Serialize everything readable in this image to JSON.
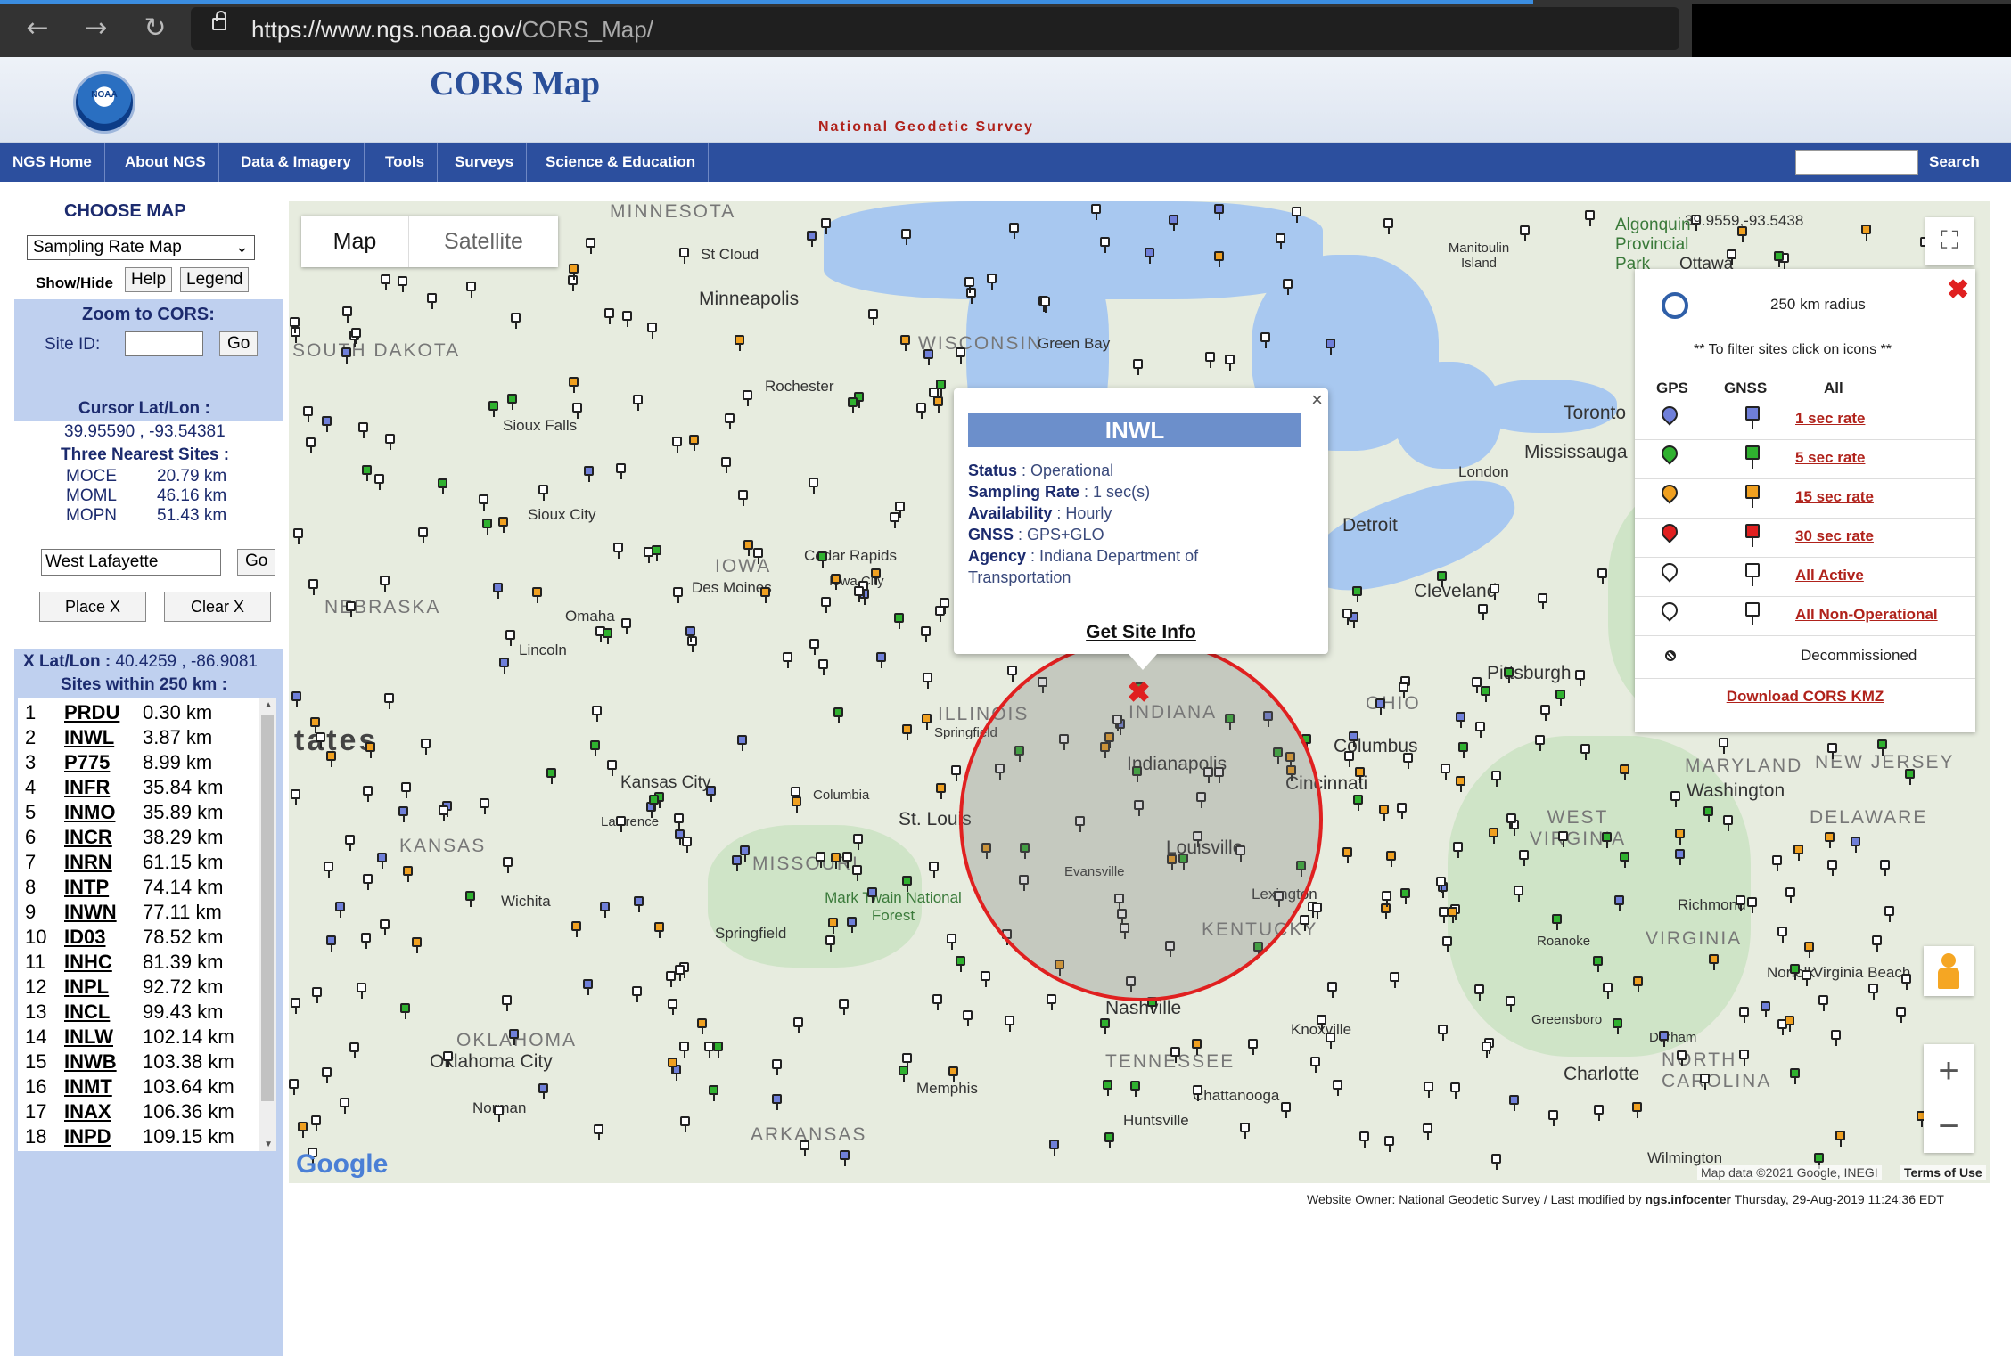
{
  "browser": {
    "url_host": "https://www.ngs.noaa.gov/",
    "url_path": "CORS_Map/"
  },
  "header": {
    "title": "CORS Map",
    "subtitle": "National Geodetic Survey"
  },
  "nav": {
    "items": [
      "NGS Home",
      "About NGS",
      "Data & Imagery",
      "Tools",
      "Surveys",
      "Science & Education"
    ],
    "search_label": "Search"
  },
  "left": {
    "choose_map": "CHOOSE MAP",
    "map_select": "Sampling Rate Map",
    "show_hide": "Show/Hide",
    "help": "Help",
    "legend": "Legend",
    "zoom_title": "Zoom to CORS:",
    "site_id_label": "Site ID:",
    "go": "Go",
    "cursor_label": "Cursor Lat/Lon :",
    "cursor_value": "39.95590 , -93.54381",
    "nearest_label": "Three Nearest Sites :",
    "nearest": [
      {
        "code": "MOCE",
        "dist": "20.79 km"
      },
      {
        "code": "MOML",
        "dist": "46.16 km"
      },
      {
        "code": "MOPN",
        "dist": "51.43 km"
      }
    ],
    "location_value": "West Lafayette",
    "place_x": "Place X",
    "clear_x": "Clear X",
    "x_latlon_label": "X Lat/Lon :",
    "x_latlon_value": "40.4259 , -86.9081",
    "within_label": "Sites within 250 km :",
    "sites": [
      {
        "n": "1",
        "code": "PRDU",
        "dist": "0.30 km"
      },
      {
        "n": "2",
        "code": "INWL",
        "dist": "3.87 km"
      },
      {
        "n": "3",
        "code": "P775",
        "dist": "8.99 km"
      },
      {
        "n": "4",
        "code": "INFR",
        "dist": "35.84 km"
      },
      {
        "n": "5",
        "code": "INMO",
        "dist": "35.89 km"
      },
      {
        "n": "6",
        "code": "INCR",
        "dist": "38.29 km"
      },
      {
        "n": "7",
        "code": "INRN",
        "dist": "61.15 km"
      },
      {
        "n": "8",
        "code": "INTP",
        "dist": "74.14 km"
      },
      {
        "n": "9",
        "code": "INWN",
        "dist": "77.11 km"
      },
      {
        "n": "10",
        "code": "ID03",
        "dist": "78.52 km"
      },
      {
        "n": "11",
        "code": "INHC",
        "dist": "81.39 km"
      },
      {
        "n": "12",
        "code": "INPL",
        "dist": "92.72 km"
      },
      {
        "n": "13",
        "code": "INCL",
        "dist": "99.43 km"
      },
      {
        "n": "14",
        "code": "INLW",
        "dist": "102.14 km"
      },
      {
        "n": "15",
        "code": "INWB",
        "dist": "103.38 km"
      },
      {
        "n": "16",
        "code": "INMT",
        "dist": "103.64 km"
      },
      {
        "n": "17",
        "code": "INAX",
        "dist": "106.36 km"
      },
      {
        "n": "18",
        "code": "INPD",
        "dist": "109.15 km"
      }
    ]
  },
  "map": {
    "tab_map": "Map",
    "tab_satellite": "Satellite",
    "coord_readout": "39.9559,-93.5438",
    "google": "Google",
    "map_data": "Map data ©2021 Google, INEGI",
    "terms": "Terms of Use",
    "labels": {
      "minnesota": "MINNESOTA",
      "minneapolis": "Minneapolis",
      "wisconsin": "WISCONSIN",
      "greenbay": "Green Bay",
      "stcloud": "St Cloud",
      "rochester": "Rochester",
      "siouxfalls": "Sioux Falls",
      "siouxcity": "Sioux City",
      "iowa": "IOWA",
      "desmoines": "Des Moines",
      "cedarrapids": "Cedar Rapids",
      "iowacity": "Iowa City",
      "nebraska": "NEBRASKA",
      "omaha": "Omaha",
      "lincoln": "Lincoln",
      "southdakota": "SOUTH DAKOTA",
      "kansas": "KANSAS",
      "kansascity": "Kansas City",
      "lawrence": "Lawrence",
      "columbia": "Columbia",
      "missouri": "MISSOURI",
      "stlouis": "St. Louis",
      "springfield_mo": "Springfield",
      "marktwain": "Mark Twain National Forest",
      "oklahoma": "OKLAHOMA",
      "oklahomacity": "Oklahoma City",
      "norman": "Norman",
      "wichita": "Wichita",
      "arkansas": "ARKANSAS",
      "illinois": "ILLINOIS",
      "springfield_il": "Springfield",
      "indiana": "INDIANA",
      "indianapolis": "Indianapolis",
      "cincinnati": "Cincinnati",
      "louisville": "Louisville",
      "evansville": "Evansville",
      "kentucky": "KENTUCKY",
      "lexington": "Lexington",
      "nashville": "Nashville",
      "tennessee": "TENNESSEE",
      "knoxville": "Knoxville",
      "chattanooga": "Chattanooga",
      "huntsville": "Huntsville",
      "memphis": "Memphis",
      "ohio": "OHIO",
      "columbus": "Columbus",
      "cleveland": "Cleveland",
      "detroit": "Detroit",
      "pittsburgh": "Pittsburgh",
      "toronto": "Toronto",
      "mississauga": "Mississauga",
      "london": "London",
      "ottawa": "Ottawa",
      "algonquin": "Algonquin Provincial Park",
      "manitoulin": "Manitoulin Island",
      "westvirginia": "WEST VIRGINIA",
      "virginia": "VIRGINIA",
      "richmond": "Richmond",
      "roanoke": "Roanoke",
      "norfolk": "Norfolk",
      "virginiabeach": "Virginia Beach",
      "maryland": "MARYLAND",
      "newjersey": "NEW JERSEY",
      "delaware": "DELAWARE",
      "washington": "Washington",
      "northcarolina": "NORTH CAROLINA",
      "charlotte": "Charlotte",
      "greensboro": "Greensboro",
      "durham": "Durham",
      "wilmington": "Wilmington",
      "states": "tates"
    }
  },
  "popup": {
    "title": "INWL",
    "status_label": "Status",
    "status": "Operational",
    "rate_label": "Sampling Rate",
    "rate": "1 sec(s)",
    "avail_label": "Availability",
    "avail": "Hourly",
    "gnss_label": "GNSS",
    "gnss": "GPS+GLO",
    "agency_label": "Agency",
    "agency": "Indiana Department of",
    "agency2": "Transportation",
    "link": "Get Site Info"
  },
  "legend": {
    "radius": "250 km radius",
    "filter": "** To filter sites click on icons **",
    "head_gps": "GPS",
    "head_gnss": "GNSS",
    "head_all": "All",
    "rows": [
      {
        "label": "1 sec rate",
        "color": "#6f7fd9"
      },
      {
        "label": "5 sec rate",
        "color": "#2fb12f"
      },
      {
        "label": "15 sec rate",
        "color": "#f0a020"
      },
      {
        "label": "30 sec rate",
        "color": "#e02020"
      },
      {
        "label": "All Active",
        "color": "#ffffff"
      },
      {
        "label": "All Non-Operational",
        "color": "#ffffff"
      }
    ],
    "decommissioned": "Decommissioned",
    "kmz": "Download CORS KMZ"
  },
  "footer": {
    "text": "Website Owner: National Geodetic Survey  /  Last modified by ",
    "by": "ngs.infocenter",
    "date": " Thursday, 29-Aug-2019 11:24:36 EDT"
  }
}
